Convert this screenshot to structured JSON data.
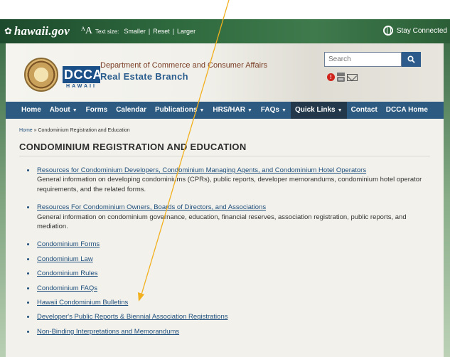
{
  "topbar": {
    "site": "hawaii.gov",
    "text_size_label": "Text size:",
    "text_size_options": [
      "Smaller",
      "Reset",
      "Larger"
    ],
    "stay": "Stay Connected"
  },
  "header": {
    "logo": "DCCA",
    "logo_sub": "HAWAII",
    "dept": "Department of Commerce and Consumer Affairs",
    "branch": "Real Estate Branch",
    "search_placeholder": "Search"
  },
  "nav": [
    {
      "label": "Home",
      "caret": false
    },
    {
      "label": "About",
      "caret": true
    },
    {
      "label": "Forms",
      "caret": false
    },
    {
      "label": "Calendar",
      "caret": false
    },
    {
      "label": "Publications",
      "caret": true
    },
    {
      "label": "HRS/HAR",
      "caret": true
    },
    {
      "label": "FAQs",
      "caret": true
    },
    {
      "label": "Quick Links",
      "caret": true
    },
    {
      "label": "Contact",
      "caret": false
    },
    {
      "label": "DCCA Home",
      "caret": false
    }
  ],
  "content": {
    "breadcrumb_home": "Home",
    "breadcrumb_sep": " » ",
    "breadcrumb_current": "Condominium Registration and Education",
    "title": "CONDOMINIUM REGISTRATION AND EDUCATION",
    "items": [
      {
        "link": "Resources for Condominium Developers, Condominium Managing Agents, and Condominium Hotel Operators",
        "desc": "General information on developing condominiums (CPRs), public reports, developer memorandums, condominium hotel operator requirements, and the related forms."
      },
      {
        "link": "Resources For Condominium Owners, Boards of Directors, and Associations",
        "desc": "General information on condominium governance, education, financial reserves, association registration, public reports, and mediation."
      },
      {
        "link": "Condominium Forms"
      },
      {
        "link": "Condominium Law"
      },
      {
        "link": "Condominium Rules"
      },
      {
        "link": "Condominium FAQs"
      },
      {
        "link": "Hawaii Condominium Bulletins"
      },
      {
        "link": "Developer's Public Reports & Biennial Association Registrations"
      },
      {
        "link": "Non-Binding Interpretations and Memorandums"
      }
    ]
  },
  "colors": {
    "nav": "#2c5a80",
    "link": "#1f4f7c",
    "arrow": "#f2b01e",
    "alert": "#d0241c"
  }
}
